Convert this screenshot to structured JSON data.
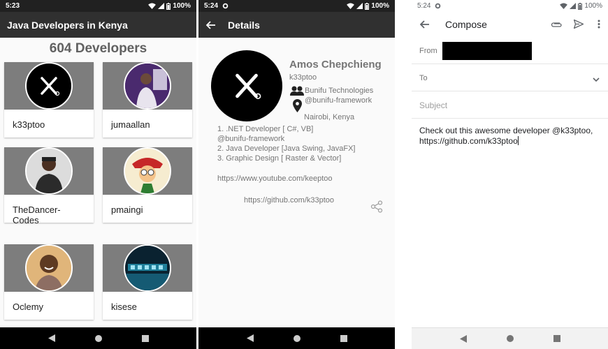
{
  "screens": [
    {
      "status": {
        "time": "5:23",
        "battery": "100%"
      },
      "app_title": "Java Developers in Kenya",
      "count_label": "604 Developers",
      "developers": [
        {
          "name": "k33ptoo",
          "avatar": "logo-icon"
        },
        {
          "name": "jumaallan",
          "avatar": "photo"
        },
        {
          "name": "TheDancer-Codes",
          "avatar": "photo"
        },
        {
          "name": "pmaingi",
          "avatar": "cartoon"
        },
        {
          "name": "Oclemy",
          "avatar": "photo"
        },
        {
          "name": "kisese",
          "avatar": "banner"
        }
      ]
    },
    {
      "status": {
        "time": "5:24",
        "battery": "100%"
      },
      "app_title": "Details",
      "name": "Amos Chepchieng",
      "handle": "k33ptoo",
      "company": "Bunifu Technologies",
      "company_handle": "@bunifu-framework",
      "location": "Nairobi, Kenya",
      "skills": [
        "1. .NET Developer [ C#, VB]",
        "@bunifu-framework",
        "2. Java Developer [Java Swing, JavaFX]",
        "3. Graphic Design [ Raster & Vector]"
      ],
      "youtube": "https://www.youtube.com/keeptoo",
      "github": "https://github.com/k33ptoo"
    },
    {
      "status": {
        "time": "5:24",
        "battery": "100%"
      },
      "app_title": "Compose",
      "from_label": "From",
      "to_label": "To",
      "subject_placeholder": "Subject",
      "body_line1": "Check out this awesome developer @k33ptoo,",
      "body_line2": "https://github.com/k33ptoo"
    }
  ],
  "colors": {
    "appbar_dark": "#303030",
    "card_band": "#7d7d7d",
    "muted_text": "#757575"
  }
}
